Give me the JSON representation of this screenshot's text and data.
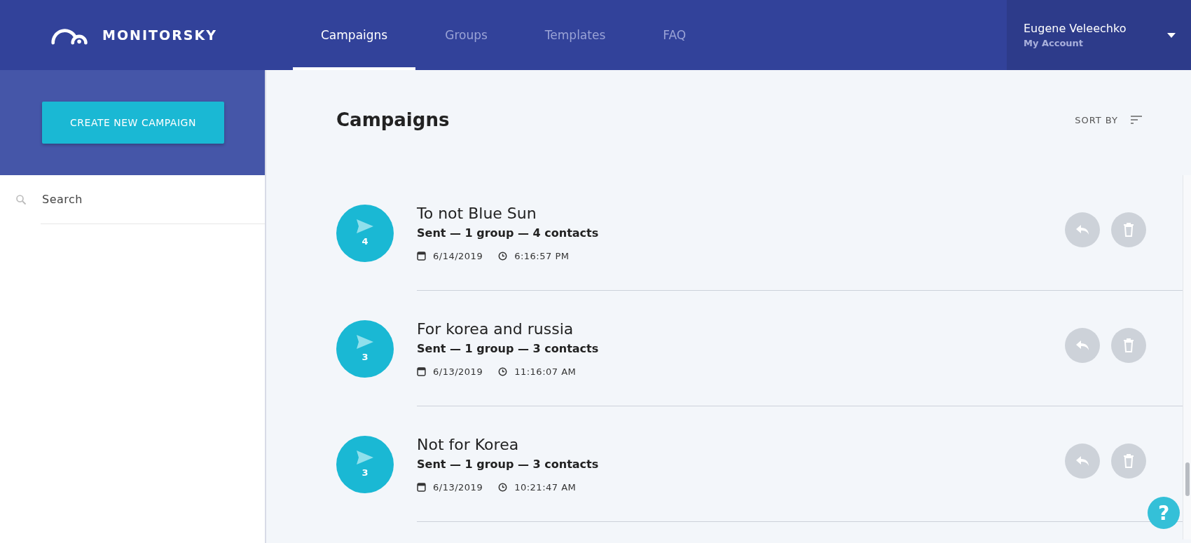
{
  "brand": {
    "name": "MONITORSKY"
  },
  "nav": [
    {
      "label": "Campaigns",
      "selected": true
    },
    {
      "label": "Groups",
      "selected": false
    },
    {
      "label": "Templates",
      "selected": false
    },
    {
      "label": "FAQ",
      "selected": false
    }
  ],
  "account": {
    "name": "Eugene Veleechko",
    "subtitle": "My Account"
  },
  "sidebar": {
    "create_button": "CREATE NEW CAMPAIGN",
    "search": {
      "placeholder": "Search"
    }
  },
  "main": {
    "title": "Campaigns",
    "sort_label": "SORT BY"
  },
  "campaigns": [
    {
      "name": "To not Blue Sun",
      "count": "4",
      "summary": "Sent — 1 group — 4 contacts",
      "date": "6/14/2019",
      "time": "6:16:57 PM"
    },
    {
      "name": "For korea and russia",
      "count": "3",
      "summary": "Sent — 1 group — 3 contacts",
      "date": "6/13/2019",
      "time": "11:16:07 AM"
    },
    {
      "name": "Not for Korea",
      "count": "3",
      "summary": "Sent — 1 group — 3 contacts",
      "date": "6/13/2019",
      "time": "10:21:47 AM"
    }
  ],
  "help": {
    "label": "?"
  }
}
